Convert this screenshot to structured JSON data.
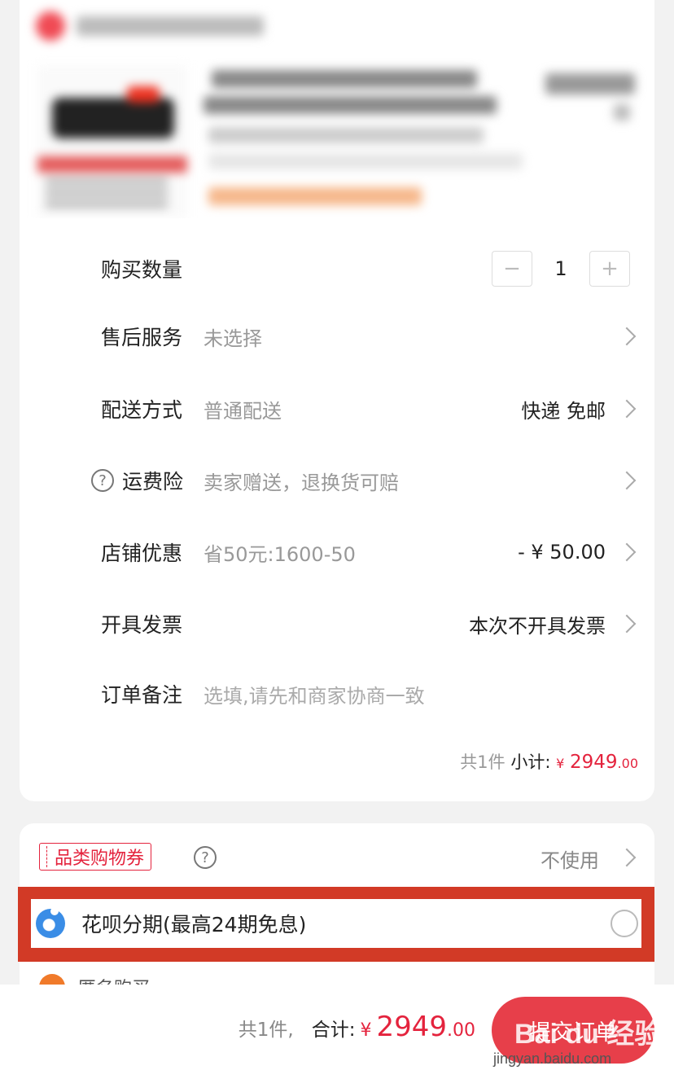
{
  "rows": {
    "quantity": {
      "label": "购买数量",
      "value": "1",
      "minus": "−",
      "plus": "+"
    },
    "after_sales": {
      "label": "售后服务",
      "value": "未选择"
    },
    "delivery": {
      "label": "配送方式",
      "value": "普通配送",
      "right": "快递 免邮"
    },
    "shipping_insurance": {
      "label": "运费险",
      "value": "卖家赠送，退换货可赔",
      "help": "?"
    },
    "shop_discount": {
      "label": "店铺优惠",
      "value": "省50元:1600-50",
      "right": "- ¥ 50.00"
    },
    "invoice": {
      "label": "开具发票",
      "right": "本次不开具发票"
    },
    "remark": {
      "label": "订单备注",
      "placeholder": "选填,请先和商家协商一致"
    }
  },
  "subtotal": {
    "count": "共1件",
    "label": "小计:",
    "currency": "¥",
    "integer": "2949",
    "decimal": ".00"
  },
  "coupon": {
    "badge": "品类购物券",
    "help": "?",
    "right": "不使用"
  },
  "huabei": {
    "label": "花呗分期(最高24期免息)"
  },
  "anonymous": {
    "label": "匿名购买"
  },
  "bottom_bar": {
    "count": "共1件,",
    "label": "合计:",
    "currency": "¥",
    "integer": "2949",
    "decimal": ".00",
    "submit": "提交订单"
  },
  "watermark": {
    "brand": "Bai du 经验",
    "url": "jingyan.baidu.com"
  },
  "colors": {
    "accent_red": "#e4233d",
    "highlight_border": "#d23a26",
    "submit_bg": "#e73f4a"
  },
  "icons": {
    "chevron": "chevron-right-icon",
    "help": "question-circle-icon",
    "huabei": "huabei-icon",
    "radio": "radio-circle"
  }
}
